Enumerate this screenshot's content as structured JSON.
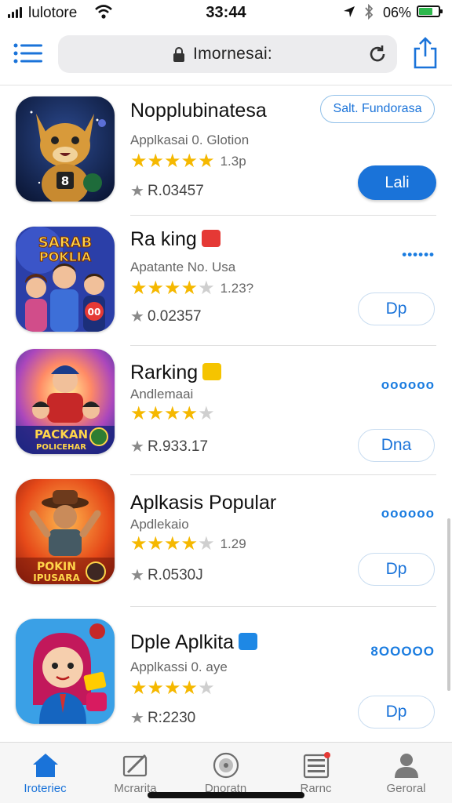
{
  "status_bar": {
    "carrier": "lulotore",
    "time": "33:44",
    "battery_pct": "06%",
    "battery_level": 0.7
  },
  "browser": {
    "url": "Imornesai:",
    "icons": [
      "menu-icon",
      "lock-icon",
      "reload-icon",
      "share-icon"
    ]
  },
  "apps": [
    {
      "title": "Nopplubinatesa",
      "subtitle": "Applkasai 0. Glotion",
      "stars": 5,
      "rating_count": "1.3p",
      "downloads": "R.03457",
      "tag": "Salt. Fundorasa",
      "action": "Lali",
      "action_style": "filled",
      "badge_color": ""
    },
    {
      "title": "Ra king",
      "subtitle": "Apatante No. Usa",
      "stars": 4,
      "rating_count": "1.23?",
      "downloads": "0.02357",
      "more": "••••••",
      "action": "Dp",
      "action_style": "outline",
      "icon_text": [
        "SARAB",
        "POKLIA"
      ],
      "badge_color": "#e53935"
    },
    {
      "title": "Rarking",
      "subtitle": "Andlemaai",
      "stars": 4,
      "rating_count": "",
      "downloads": "R.933.17",
      "more": "oooooo",
      "action": "Dna",
      "action_style": "outline",
      "icon_text": [
        "PACKAN",
        "POLICEHAR"
      ],
      "badge_color": "#f5c400"
    },
    {
      "title": "Aplkasis Popular",
      "subtitle": "Apdlekaio",
      "stars": 4,
      "rating_count": "1.29",
      "downloads": "R.0530J",
      "more": "oooooo",
      "action": "Dp",
      "action_style": "outline",
      "icon_text": [
        "POKIN",
        "IPUSARA"
      ],
      "badge_color": ""
    },
    {
      "title": "Dple Aplkita",
      "subtitle": "Applkassi 0. aye",
      "stars": 4,
      "rating_count": "",
      "downloads": "R:2230",
      "more": "8OOOOO",
      "action": "Dp",
      "action_style": "outline",
      "badge_color": "#1e88e5"
    }
  ],
  "tabs": [
    {
      "label": "Iroteriec",
      "icon": "home-icon",
      "active": true
    },
    {
      "label": "Mcrarita",
      "icon": "compose-icon",
      "active": false
    },
    {
      "label": "Dnoratn",
      "icon": "target-icon",
      "active": false
    },
    {
      "label": "Rarnc",
      "icon": "list-icon",
      "active": false
    },
    {
      "label": "Geroral",
      "icon": "person-icon",
      "active": false
    }
  ],
  "colors": {
    "accent": "#1a73d9",
    "star": "#f5b800"
  }
}
